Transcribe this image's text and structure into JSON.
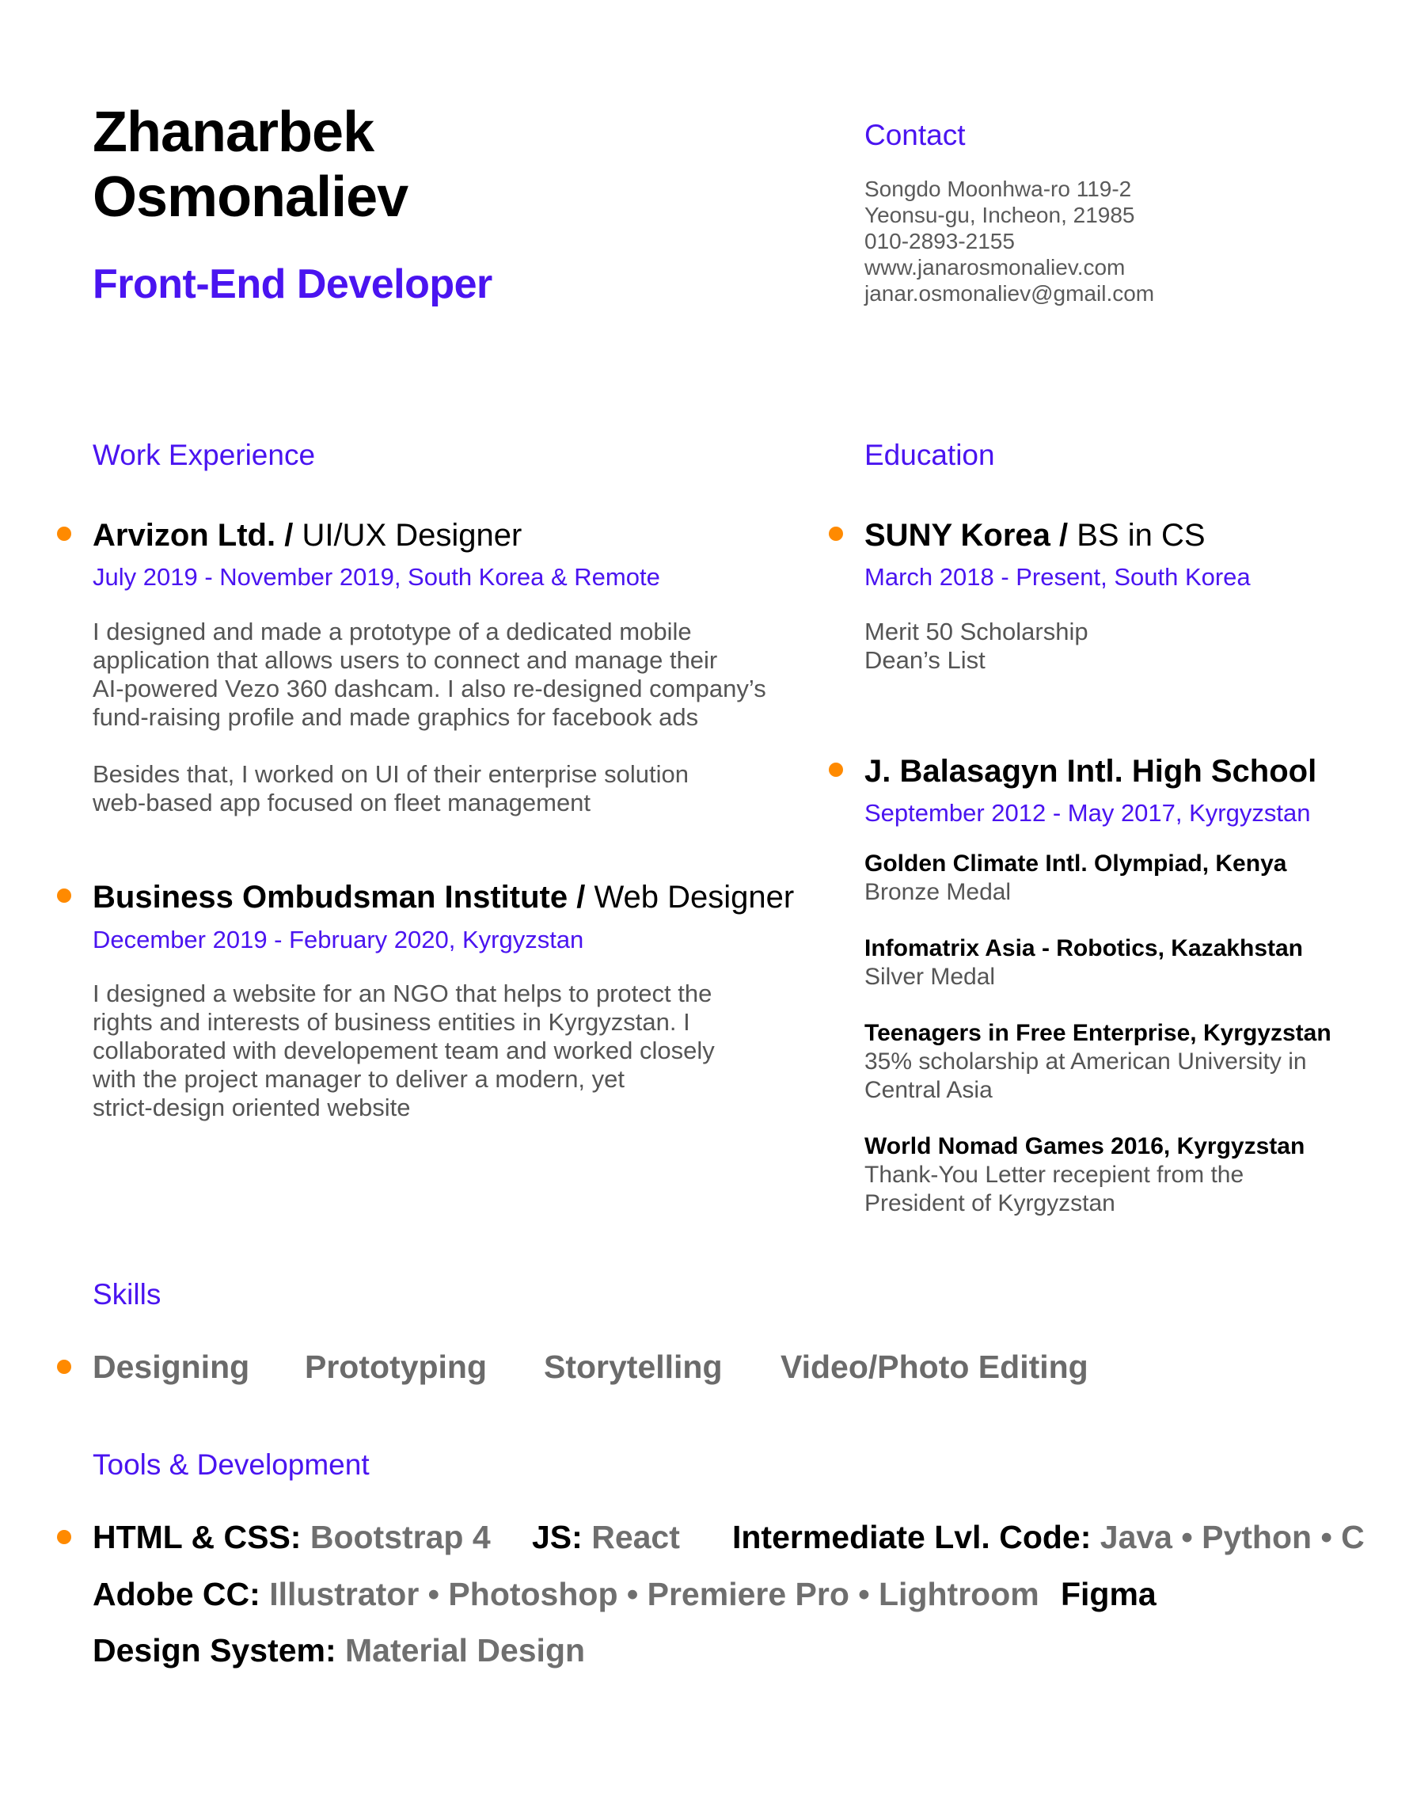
{
  "header": {
    "first_name": "Zhanarbek",
    "last_name": "Osmonaliev",
    "role": "Front-End Developer"
  },
  "contact": {
    "title": "Contact",
    "lines": [
      "Songdo Moonhwa-ro 119-2",
      "Yeonsu-gu, Incheon, 21985",
      "010-2893-2155",
      "www.janarosmonaliev.com",
      "janar.osmonaliev@gmail.com"
    ]
  },
  "work": {
    "title": "Work Experience",
    "jobs": [
      {
        "company": "Arvizon Ltd. /",
        "position": " UI/UX Designer",
        "dates": "July 2019 - November 2019, South Korea & Remote",
        "para1": [
          "I designed and made a prototype of a dedicated mobile",
          "application that allows users to connect and manage their",
          "AI-powered Vezo 360 dashcam. I also re-designed company’s",
          "fund-raising profile and made graphics for facebook ads"
        ],
        "para2": [
          "Besides that, I worked on UI of their enterprise solution",
          "web-based app focused on fleet management"
        ]
      },
      {
        "company": "Business Ombudsman Institute /",
        "position": " Web Designer",
        "dates": "December 2019 - February 2020, Kyrgyzstan",
        "para1": [
          "I designed a website for an NGO that helps to protect the",
          "rights and interests of business entities in Kyrgyzstan. I",
          "collaborated with developement team and worked closely",
          "with the project manager to deliver a modern, yet",
          "strict-design oriented website"
        ]
      }
    ]
  },
  "education": {
    "title": "Education",
    "schools": [
      {
        "name": "SUNY Korea /",
        "degree": " BS in CS",
        "dates": "March 2018 - Present, South Korea",
        "notes": [
          "Merit 50 Scholarship",
          "Dean’s List"
        ]
      },
      {
        "name": "J. Balasagyn Intl. High School",
        "dates": "September 2012 - May 2017, Kyrgyzstan",
        "awards": [
          {
            "name": "Golden Climate Intl. Olympiad, Kenya",
            "detail": [
              "Bronze Medal"
            ]
          },
          {
            "name": "Infomatrix Asia - Robotics, Kazakhstan",
            "detail": [
              "Silver Medal"
            ]
          },
          {
            "name": "Teenagers in Free Enterprise, Kyrgyzstan",
            "detail": [
              "35% scholarship at American University in",
              "Central Asia"
            ]
          },
          {
            "name": "World Nomad Games 2016, Kyrgyzstan",
            "detail": [
              "Thank-You Letter recepient from the",
              "President of Kyrgyzstan"
            ]
          }
        ]
      }
    ]
  },
  "skills": {
    "title": "Skills",
    "items": [
      "Designing",
      "Prototyping",
      "Storytelling",
      "Video/Photo Editing"
    ]
  },
  "tools": {
    "title": "Tools & Development",
    "html_k": "HTML & CSS:",
    "html_v": " Bootstrap 4",
    "js_k": "JS:",
    "js_v": " React",
    "code_k": "Intermediate Lvl. Code:",
    "code_v": " Java • Python • C",
    "adobe_k": "Adobe CC:",
    "adobe_v": " Illustrator • Photoshop • Premiere Pro • Lightroom",
    "figma": "Figma",
    "ds_k": "Design System:",
    "ds_v": " Material Design"
  },
  "colors": {
    "accent": "#4a14f0",
    "bullet": "#ff8a00"
  }
}
